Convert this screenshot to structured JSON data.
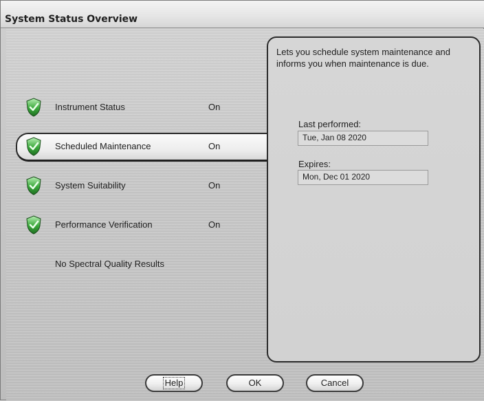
{
  "window": {
    "title": "System Status Overview"
  },
  "status_list": [
    {
      "label": "Instrument Status",
      "state": "On",
      "icon": "green-shield-check-icon"
    },
    {
      "label": "Scheduled Maintenance",
      "state": "On",
      "icon": "green-shield-check-icon",
      "selected": true
    },
    {
      "label": "System Suitability",
      "state": "On",
      "icon": "green-shield-check-icon"
    },
    {
      "label": "Performance Verification",
      "state": "On",
      "icon": "green-shield-check-icon"
    },
    {
      "label": "No Spectral Quality Results",
      "state": ""
    }
  ],
  "detail": {
    "description": "Lets you schedule system maintenance and informs you when maintenance is due.",
    "last_performed_label": "Last performed:",
    "last_performed_value": "Tue, Jan 08 2020",
    "expires_label": "Expires:",
    "expires_value": "Mon, Dec 01 2020"
  },
  "buttons": {
    "help": "Help",
    "ok": "OK",
    "cancel": "Cancel"
  },
  "colors": {
    "shield_green": "#39a83a",
    "panel_border": "#2b2b2b"
  }
}
